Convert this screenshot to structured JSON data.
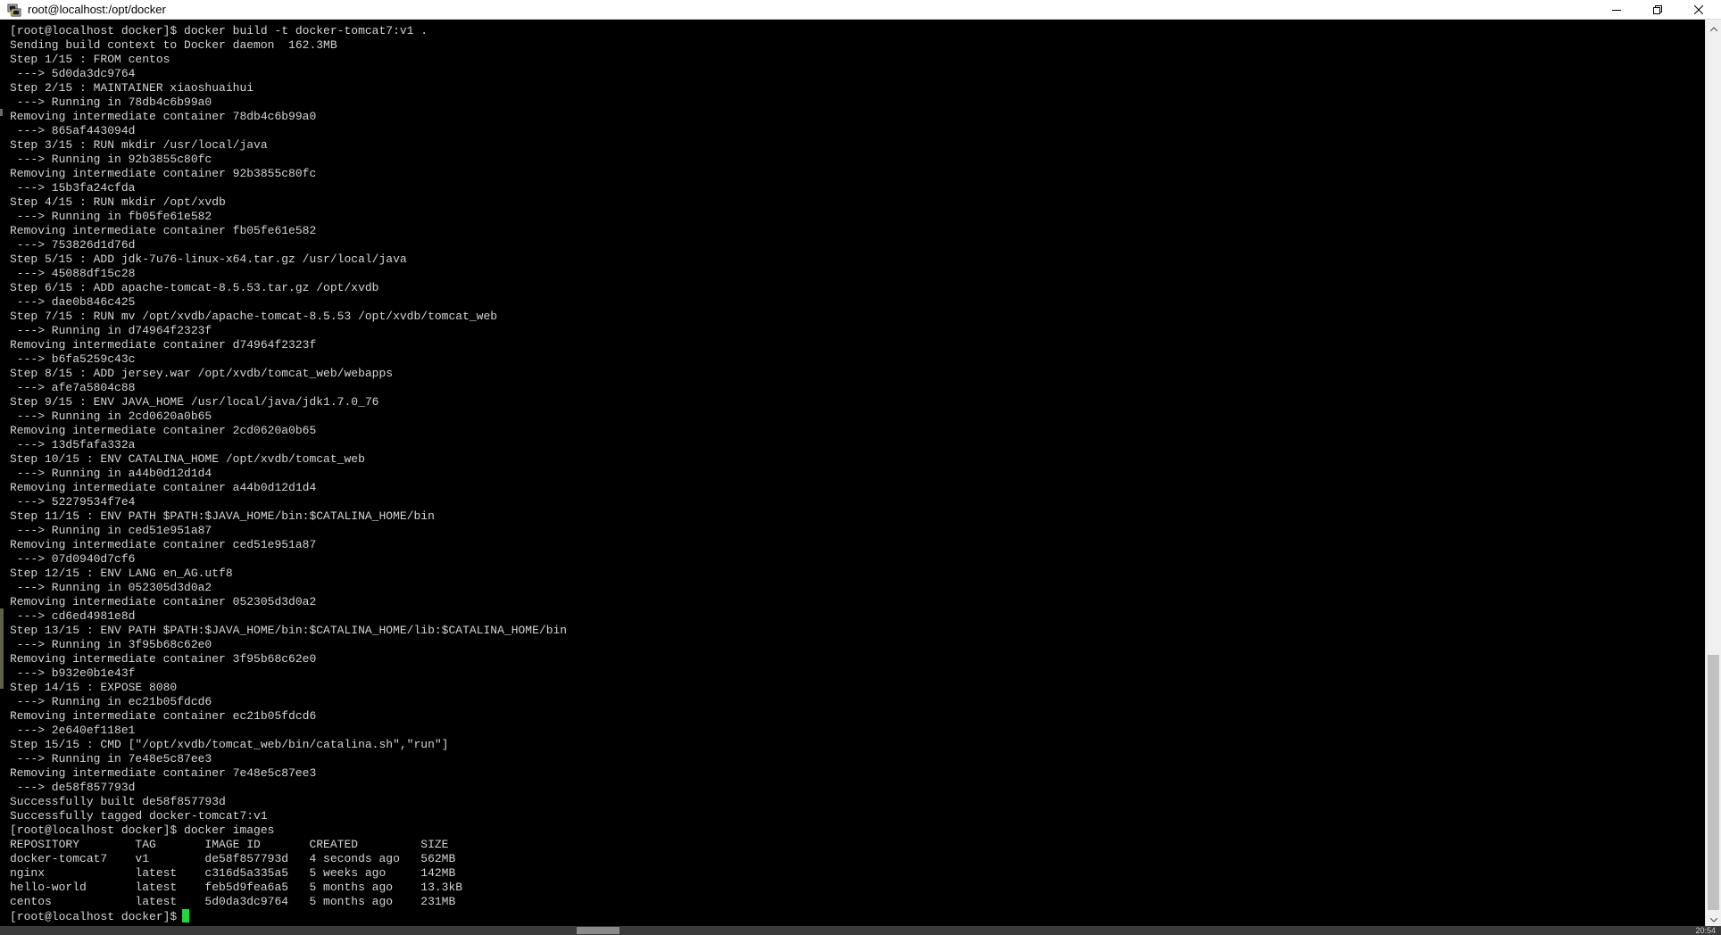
{
  "window": {
    "title": "root@localhost:/opt/docker",
    "icon": "putty-terminal-icon",
    "controls": {
      "minimize_icon": "minimize-icon",
      "maximize_icon": "restore-icon",
      "close_icon": "close-icon"
    }
  },
  "colors": {
    "terminal_background": "#000000",
    "terminal_text": "#d4d4d4",
    "cursor": "#27d43a",
    "titlebar": "#ffffff"
  },
  "terminal": {
    "lines": [
      "[root@localhost docker]$ docker build -t docker-tomcat7:v1 .",
      "Sending build context to Docker daemon  162.3MB",
      "Step 1/15 : FROM centos",
      " ---> 5d0da3dc9764",
      "Step 2/15 : MAINTAINER xiaoshuaihui",
      " ---> Running in 78db4c6b99a0",
      "Removing intermediate container 78db4c6b99a0",
      " ---> 865af443094d",
      "Step 3/15 : RUN mkdir /usr/local/java",
      " ---> Running in 92b3855c80fc",
      "Removing intermediate container 92b3855c80fc",
      " ---> 15b3fa24cfda",
      "Step 4/15 : RUN mkdir /opt/xvdb",
      " ---> Running in fb05fe61e582",
      "Removing intermediate container fb05fe61e582",
      " ---> 753826d1d76d",
      "Step 5/15 : ADD jdk-7u76-linux-x64.tar.gz /usr/local/java",
      " ---> 45088df15c28",
      "Step 6/15 : ADD apache-tomcat-8.5.53.tar.gz /opt/xvdb",
      " ---> dae0b846c425",
      "Step 7/15 : RUN mv /opt/xvdb/apache-tomcat-8.5.53 /opt/xvdb/tomcat_web",
      " ---> Running in d74964f2323f",
      "Removing intermediate container d74964f2323f",
      " ---> b6fa5259c43c",
      "Step 8/15 : ADD jersey.war /opt/xvdb/tomcat_web/webapps",
      " ---> afe7a5804c88",
      "Step 9/15 : ENV JAVA_HOME /usr/local/java/jdk1.7.0_76",
      " ---> Running in 2cd0620a0b65",
      "Removing intermediate container 2cd0620a0b65",
      " ---> 13d5fafa332a",
      "Step 10/15 : ENV CATALINA_HOME /opt/xvdb/tomcat_web",
      " ---> Running in a44b0d12d1d4",
      "Removing intermediate container a44b0d12d1d4",
      " ---> 52279534f7e4",
      "Step 11/15 : ENV PATH $PATH:$JAVA_HOME/bin:$CATALINA_HOME/bin",
      " ---> Running in ced51e951a87",
      "Removing intermediate container ced51e951a87",
      " ---> 07d0940d7cf6",
      "Step 12/15 : ENV LANG en_AG.utf8",
      " ---> Running in 052305d3d0a2",
      "Removing intermediate container 052305d3d0a2",
      " ---> cd6ed4981e8d",
      "Step 13/15 : ENV PATH $PATH:$JAVA_HOME/bin:$CATALINA_HOME/lib:$CATALINA_HOME/bin",
      " ---> Running in 3f95b68c62e0",
      "Removing intermediate container 3f95b68c62e0",
      " ---> b932e0b1e43f",
      "Step 14/15 : EXPOSE 8080",
      " ---> Running in ec21b05fdcd6",
      "Removing intermediate container ec21b05fdcd6",
      " ---> 2e640ef118e1",
      "Step 15/15 : CMD [\"/opt/xvdb/tomcat_web/bin/catalina.sh\",\"run\"]",
      " ---> Running in 7e48e5c87ee3",
      "Removing intermediate container 7e48e5c87ee3",
      " ---> de58f857793d",
      "Successfully built de58f857793d",
      "Successfully tagged docker-tomcat7:v1",
      "[root@localhost docker]$ docker images",
      "REPOSITORY        TAG       IMAGE ID       CREATED         SIZE",
      "docker-tomcat7    v1        de58f857793d   4 seconds ago   562MB",
      "nginx             latest    c316d5a335a5   5 weeks ago     142MB",
      "hello-world       latest    feb5d9fea6a5   5 months ago    13.3kB",
      "centos            latest    5d0da3dc9764   5 months ago    231MB"
    ],
    "prompt": "[root@localhost docker]$"
  },
  "statusbar": {
    "clock": "20:54"
  }
}
